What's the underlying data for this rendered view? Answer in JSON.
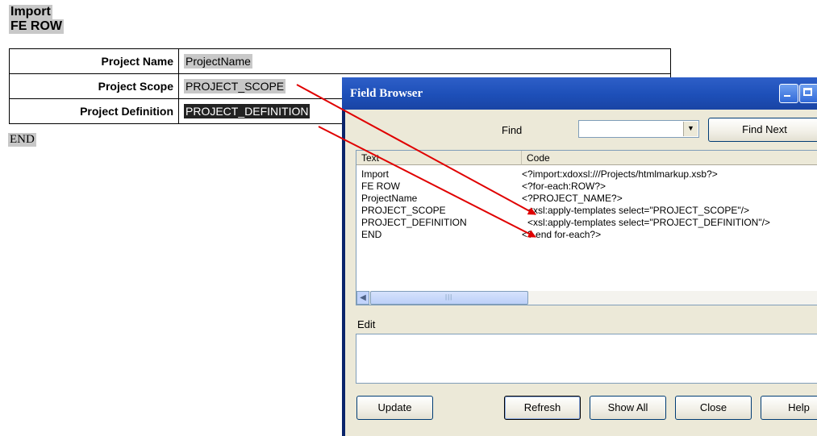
{
  "document": {
    "import_tag": "Import",
    "for_each_tag": "FE ROW",
    "end_tag": "END",
    "rows": [
      {
        "label": "Project Name",
        "field": "ProjectName"
      },
      {
        "label": "Project Scope",
        "field": "PROJECT_SCOPE"
      },
      {
        "label": "Project Definition",
        "field": "PROJECT_DEFINITION"
      }
    ]
  },
  "window": {
    "title": "Field Browser",
    "find_label": "Find",
    "find_value": "",
    "find_next_label": "Find Next",
    "columns": {
      "text": "Text",
      "code": "Code"
    },
    "fields": [
      {
        "text": "Import",
        "code": "<?import:xdoxsl:///Projects/htmlmarkup.xsb?>"
      },
      {
        "text": "FE ROW",
        "code": "<?for-each:ROW?>"
      },
      {
        "text": "ProjectName",
        "code": "<?PROJECT_NAME?>"
      },
      {
        "text": "PROJECT_SCOPE",
        "code": "<xsl:apply-templates select=\"PROJECT_SCOPE\"/>"
      },
      {
        "text": "PROJECT_DEFINITION",
        "code": "<xsl:apply-templates select=\"PROJECT_DEFINITION\"/>"
      },
      {
        "text": "END",
        "code": "<? end for-each?>"
      }
    ],
    "edit_label": "Edit",
    "edit_value": "",
    "buttons": {
      "update": "Update",
      "refresh": "Refresh",
      "show_all": "Show All",
      "close": "Close",
      "help": "Help"
    }
  },
  "colors": {
    "titlebar": "#2457c5",
    "arrow": "#e00000",
    "field_highlight": "#c8c8c8",
    "selected_field": "#222222"
  },
  "icons": {
    "minimize": "minimize-icon",
    "maximize": "maximize-icon",
    "dropdown": "chevron-down-icon",
    "scroll_left": "scroll-left-icon"
  }
}
